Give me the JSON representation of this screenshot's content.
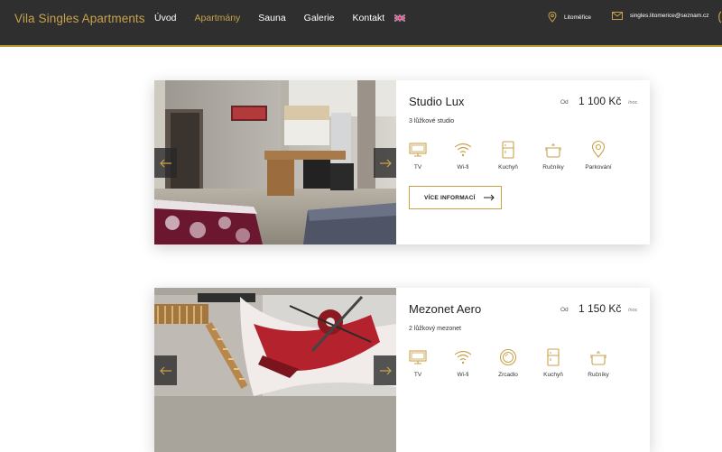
{
  "brand": "Vila Singles Apartments",
  "nav": {
    "items": [
      {
        "label": "Úvod",
        "active": false
      },
      {
        "label": "Apartmány",
        "active": true
      },
      {
        "label": "Sauna",
        "active": false
      },
      {
        "label": "Galerie",
        "active": false
      },
      {
        "label": "Kontakt",
        "active": false
      }
    ],
    "language_icon": "uk-flag-icon"
  },
  "contact": {
    "location": "Litoměřice",
    "email": "singles.litomerice@seznam.cz"
  },
  "colors": {
    "header_bg": "#2f2f2f",
    "accent": "#c8a24a"
  },
  "apartments": [
    {
      "name": "Studio Lux",
      "from_label": "Od",
      "price": "1 100 Kč",
      "per_label": "/noc",
      "subtitle": "3 lůžkové studio",
      "amenities": [
        {
          "label": "TV",
          "icon": "tv-icon"
        },
        {
          "label": "Wi-fi",
          "icon": "wifi-icon"
        },
        {
          "label": "Kuchyň",
          "icon": "fridge-icon"
        },
        {
          "label": "Ručníky",
          "icon": "pot-icon"
        },
        {
          "label": "Parkování",
          "icon": "location-pin-icon"
        }
      ],
      "button_label": "VÍCE INFORMACÍ"
    },
    {
      "name": "Mezonet Aero",
      "from_label": "Od",
      "price": "1 150 Kč",
      "per_label": "/noc",
      "subtitle": "2 lůžkový mezonet",
      "amenities": [
        {
          "label": "TV",
          "icon": "tv-icon"
        },
        {
          "label": "Wi-fi",
          "icon": "wifi-icon"
        },
        {
          "label": "Zrcadlo",
          "icon": "mirror-icon"
        },
        {
          "label": "Kuchyň",
          "icon": "fridge-icon"
        },
        {
          "label": "Ručníky",
          "icon": "pot-icon"
        }
      ]
    }
  ]
}
